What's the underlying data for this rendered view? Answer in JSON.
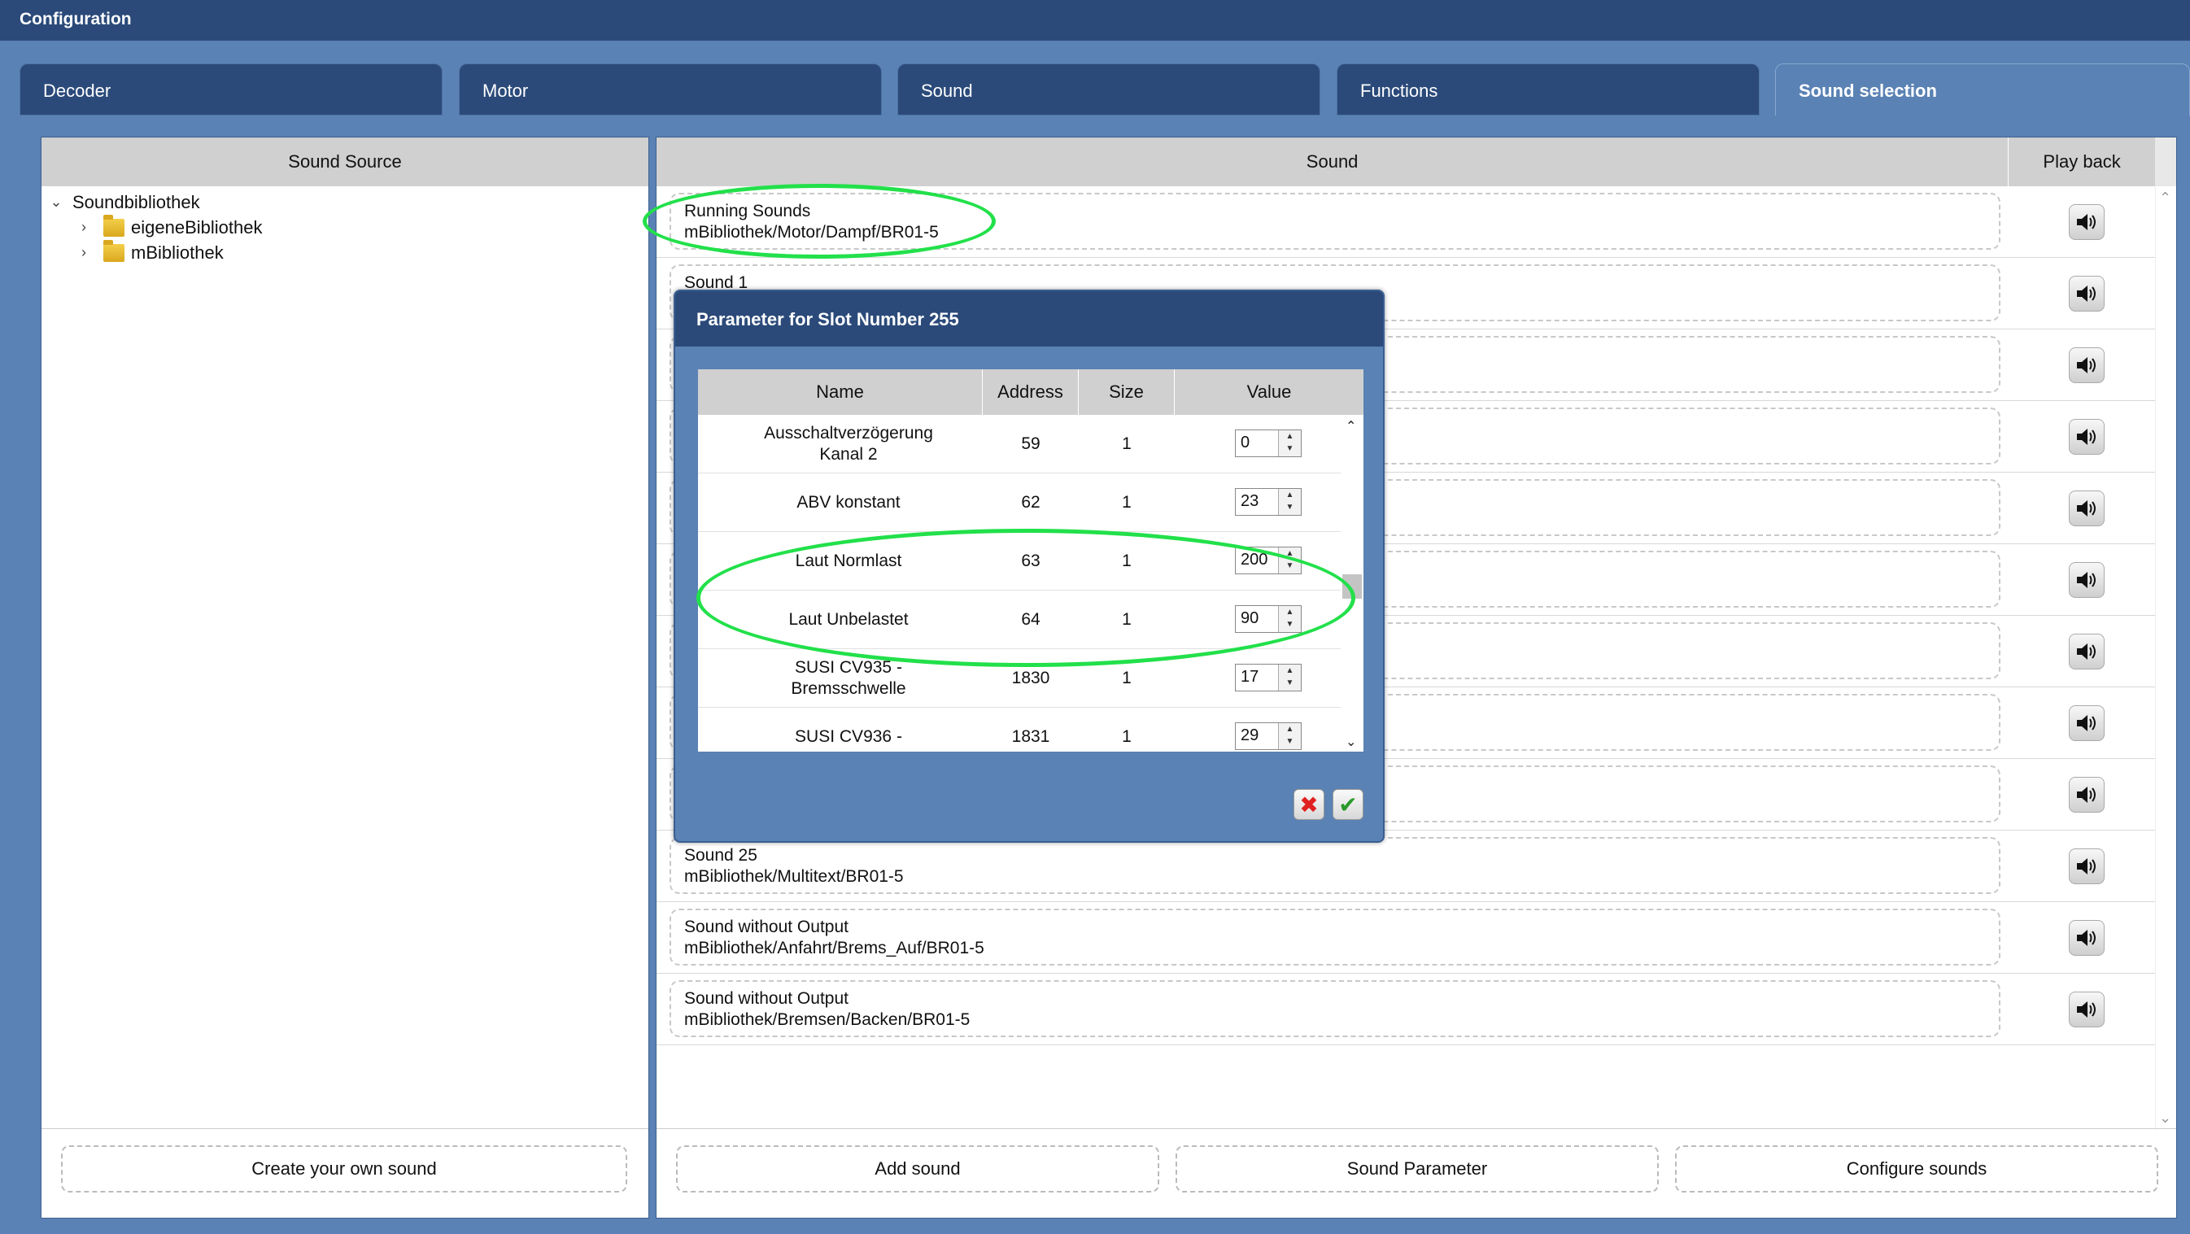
{
  "window": {
    "title": "Configuration"
  },
  "tabs": [
    {
      "label": "Decoder",
      "active": false
    },
    {
      "label": "Motor",
      "active": false
    },
    {
      "label": "Sound",
      "active": false
    },
    {
      "label": "Functions",
      "active": false
    },
    {
      "label": "Sound selection",
      "active": true
    }
  ],
  "source_panel": {
    "header": "Sound Source",
    "tree": {
      "root": "Soundbibliothek",
      "children": [
        "eigeneBibliothek",
        "mBibliothek"
      ]
    },
    "create_button": "Create your own sound"
  },
  "sound_panel": {
    "header_sound": "Sound",
    "header_playback": "Play back",
    "rows": [
      {
        "line1": "Running Sounds",
        "line2": "mBibliothek/Motor/Dampf/BR01-5"
      },
      {
        "line1": "Sound 1",
        "line2": ""
      },
      {
        "line1": "",
        "line2": ""
      },
      {
        "line1": "",
        "line2": ""
      },
      {
        "line1": "",
        "line2": ""
      },
      {
        "line1": "",
        "line2": ""
      },
      {
        "line1": "",
        "line2": ""
      },
      {
        "line1": "",
        "line2": ""
      },
      {
        "line1": "",
        "line2": ""
      },
      {
        "line1": "Sound 25",
        "line2": "mBibliothek/Multitext/BR01-5"
      },
      {
        "line1": "Sound without Output",
        "line2": "mBibliothek/Anfahrt/Brems_Auf/BR01-5"
      },
      {
        "line1": "Sound without Output",
        "line2": "mBibliothek/Bremsen/Backen/BR01-5"
      }
    ],
    "buttons": {
      "add": "Add sound",
      "parameter": "Sound Parameter",
      "configure": "Configure sounds"
    }
  },
  "dialog": {
    "title": "Parameter for Slot Number 255",
    "columns": {
      "name": "Name",
      "address": "Address",
      "size": "Size",
      "value": "Value"
    },
    "rows": [
      {
        "name_line1": "Ausschaltverzögerung",
        "name_line2": "Kanal 2",
        "address": "59",
        "size": "1",
        "value": "0"
      },
      {
        "name_line1": "ABV konstant",
        "name_line2": "",
        "address": "62",
        "size": "1",
        "value": "23"
      },
      {
        "name_line1": "Laut Normlast",
        "name_line2": "",
        "address": "63",
        "size": "1",
        "value": "200"
      },
      {
        "name_line1": "Laut Unbelastet",
        "name_line2": "",
        "address": "64",
        "size": "1",
        "value": "90"
      },
      {
        "name_line1": "SUSI CV935 -",
        "name_line2": "Bremsschwelle",
        "address": "1830",
        "size": "1",
        "value": "17"
      },
      {
        "name_line1": "SUSI CV936 -",
        "name_line2": "",
        "address": "1831",
        "size": "1",
        "value": "29"
      }
    ],
    "cancel_icon": "close-icon",
    "ok_icon": "check-icon"
  },
  "colors": {
    "titlebar": "#2b4a7a",
    "background": "#5a82b4",
    "highlight": "#22e04a"
  }
}
